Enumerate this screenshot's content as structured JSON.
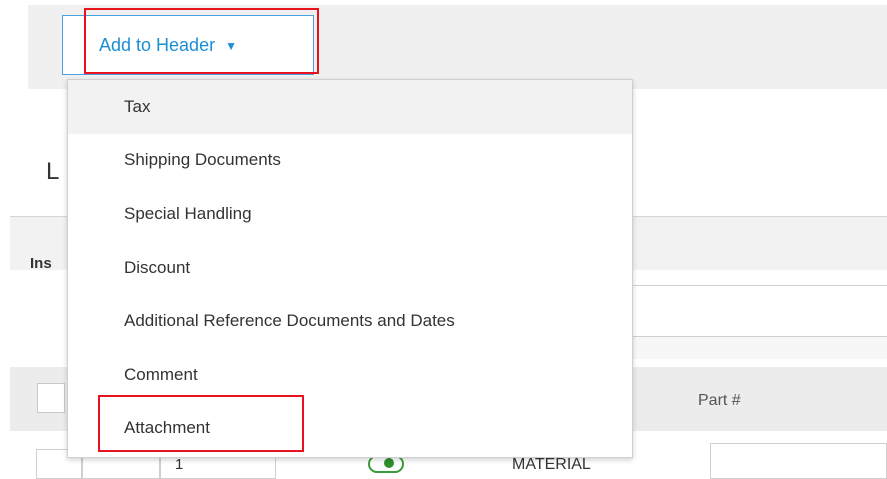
{
  "header": {
    "add_to_header_label": "Add to Header",
    "caret_icon": "caret-down-icon",
    "accent_color": "#1a8fd6",
    "highlight_color": "#e8131f"
  },
  "dropdown": {
    "items": [
      {
        "label": "Tax"
      },
      {
        "label": "Shipping Documents"
      },
      {
        "label": "Special Handling"
      },
      {
        "label": "Discount"
      },
      {
        "label": "Additional Reference Documents and Dates"
      },
      {
        "label": "Comment"
      },
      {
        "label": "Attachment"
      }
    ]
  },
  "background": {
    "section_letter": "L",
    "insert_label": "Ins",
    "part_label": "Part #",
    "line_number": "1",
    "material_text": "MATERIAL"
  }
}
